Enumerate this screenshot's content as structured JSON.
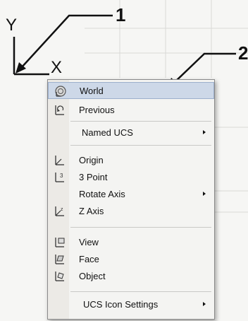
{
  "callouts": [
    "1",
    "2"
  ],
  "axis": {
    "y_label": "Y",
    "x_label": "X"
  },
  "menu": {
    "items": [
      {
        "label": "World",
        "icon": "ucs-world-icon",
        "submenu": false,
        "highlighted": true
      },
      {
        "label": "Previous",
        "icon": "ucs-previous-icon",
        "submenu": false
      },
      {
        "label": "Named UCS",
        "icon": "",
        "submenu": true
      },
      {
        "label": "Origin",
        "icon": "ucs-origin-icon",
        "submenu": false
      },
      {
        "label": "3 Point",
        "icon": "ucs-3point-icon",
        "submenu": false
      },
      {
        "label": "Rotate Axis",
        "icon": "",
        "submenu": true
      },
      {
        "label": "Z Axis",
        "icon": "ucs-zaxis-icon",
        "submenu": false
      },
      {
        "label": "View",
        "icon": "ucs-view-icon",
        "submenu": false
      },
      {
        "label": "Face",
        "icon": "ucs-face-icon",
        "submenu": false
      },
      {
        "label": "Object",
        "icon": "ucs-object-icon",
        "submenu": false
      },
      {
        "label": "UCS Icon Settings",
        "icon": "",
        "submenu": true
      }
    ]
  },
  "colors": {
    "highlight": "#cdd8e8",
    "menu_bg": "#f4f4f2",
    "border": "#8a8a8a"
  }
}
